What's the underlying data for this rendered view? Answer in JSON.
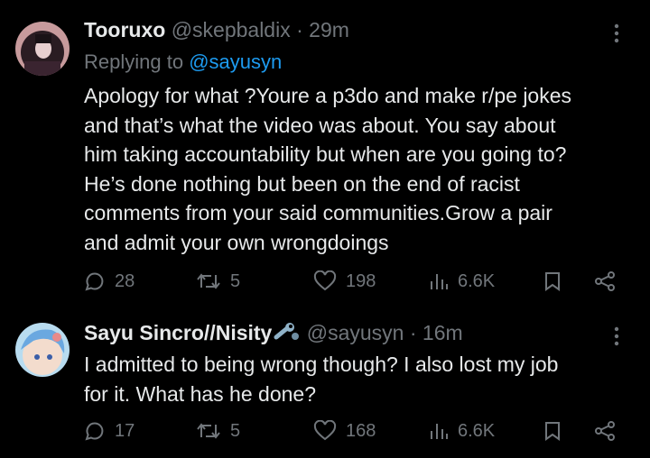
{
  "tweets": [
    {
      "display_name": "Tooruxo",
      "handle": "@skepbaldix",
      "time": "· 29m",
      "replying_prefix": "Replying to",
      "replying_handle": "@sayusyn",
      "body": "Apology for what ?Youre a p3do and make r/pe jokes\nand that’s what the video was about. You say about\nhim taking accountability but when are you going to?\nHe’s done nothing but been on the end of racist\ncomments from your said communities.Grow a pair\nand admit your own wrongdoings",
      "replies": "28",
      "retweets": "5",
      "likes": "198",
      "views": "6.6K"
    },
    {
      "display_name": "Sayu Sincro//Nisity",
      "handle": "@sayusyn",
      "time": "· 16m",
      "body": "I admitted to being wrong though? I also lost my job\nfor it. What has he done?",
      "replies": "17",
      "retweets": "5",
      "likes": "168",
      "views": "6.6K"
    }
  ],
  "icons": {
    "reply": "speech-bubble-icon",
    "retweet": "retweet-icon",
    "like": "heart-icon",
    "views": "bar-chart-icon",
    "bookmark": "bookmark-icon",
    "share": "share-icon",
    "more": "more-dots-icon",
    "badge": "wrench-icon"
  },
  "colors": {
    "background": "#000000",
    "text": "#e7e9ea",
    "muted": "#71767b",
    "link": "#1d9bf0"
  }
}
